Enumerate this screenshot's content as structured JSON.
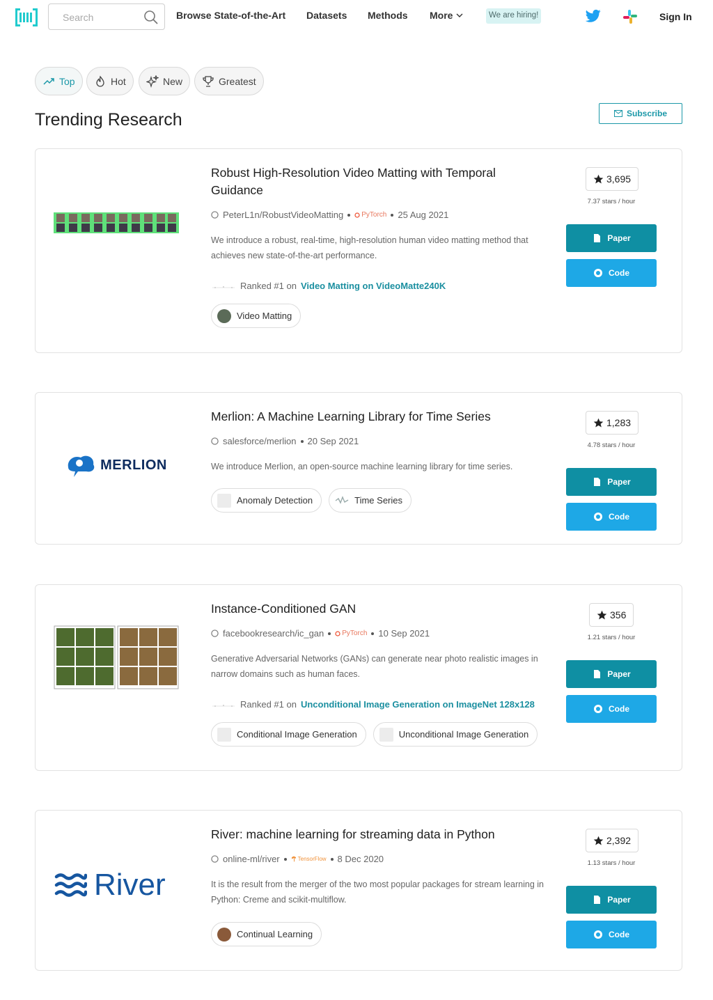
{
  "nav": {
    "search_placeholder": "Search",
    "links": [
      "Browse State-of-the-Art",
      "Datasets",
      "Methods",
      "More"
    ],
    "hiring": "We are hiring!",
    "sign_in": "Sign In"
  },
  "tabs": [
    {
      "label": "Top",
      "icon": "trending-up-icon",
      "active": true
    },
    {
      "label": "Hot",
      "icon": "flame-icon",
      "active": false
    },
    {
      "label": "New",
      "icon": "sparkle-icon",
      "active": false
    },
    {
      "label": "Greatest",
      "icon": "trophy-icon",
      "active": false
    }
  ],
  "page_title": "Trending Research",
  "subscribe_label": "Subscribe",
  "colors": {
    "accent": "#1b98a8",
    "paper_button": "#0f8fa3",
    "code_button": "#1ea8e6"
  },
  "papers": [
    {
      "title": "Robust High-Resolution Video Matting with Temporal Guidance",
      "repo": "PeterL1n/RobustVideoMatting",
      "framework": "PyTorch",
      "date": "25 Aug 2021",
      "description": "We introduce a robust, real-time, high-resolution human video matting method that achieves new state-of-the-art performance.",
      "ranked_prefix": "Ranked #1 on",
      "ranked_link": "Video Matting on VideoMatte240K",
      "tags": [
        "Video Matting"
      ],
      "stars": "3,695",
      "rate": "7.37 stars / hour",
      "paper_label": "Paper",
      "code_label": "Code"
    },
    {
      "title": "Merlion: A Machine Learning Library for Time Series",
      "repo": "salesforce/merlion",
      "date": "20 Sep 2021",
      "description": "We introduce Merlion, an open-source machine learning library for time series.",
      "logo_text": "MERLION",
      "tags": [
        "Anomaly Detection",
        "Time Series"
      ],
      "stars": "1,283",
      "rate": "4.78 stars / hour",
      "paper_label": "Paper",
      "code_label": "Code"
    },
    {
      "title": "Instance-Conditioned GAN",
      "repo": "facebookresearch/ic_gan",
      "framework": "PyTorch",
      "date": "10 Sep 2021",
      "description": "Generative Adversarial Networks (GANs) can generate near photo realistic images in narrow domains such as human faces.",
      "ranked_prefix": "Ranked #1 on",
      "ranked_link": "Unconditional Image Generation on ImageNet 128x128",
      "tags": [
        "Conditional Image Generation",
        "Unconditional Image Generation"
      ],
      "stars": "356",
      "rate": "1.21 stars / hour",
      "paper_label": "Paper",
      "code_label": "Code"
    },
    {
      "title": "River: machine learning for streaming data in Python",
      "repo": "online-ml/river",
      "framework": "TensorFlow",
      "date": "8 Dec 2020",
      "description": "It is the result from the merger of the two most popular packages for stream learning in Python: Creme and scikit-multiflow.",
      "logo_text": "River",
      "tags": [
        "Continual Learning"
      ],
      "stars": "2,392",
      "rate": "1.13 stars / hour",
      "paper_label": "Paper",
      "code_label": "Code"
    }
  ]
}
